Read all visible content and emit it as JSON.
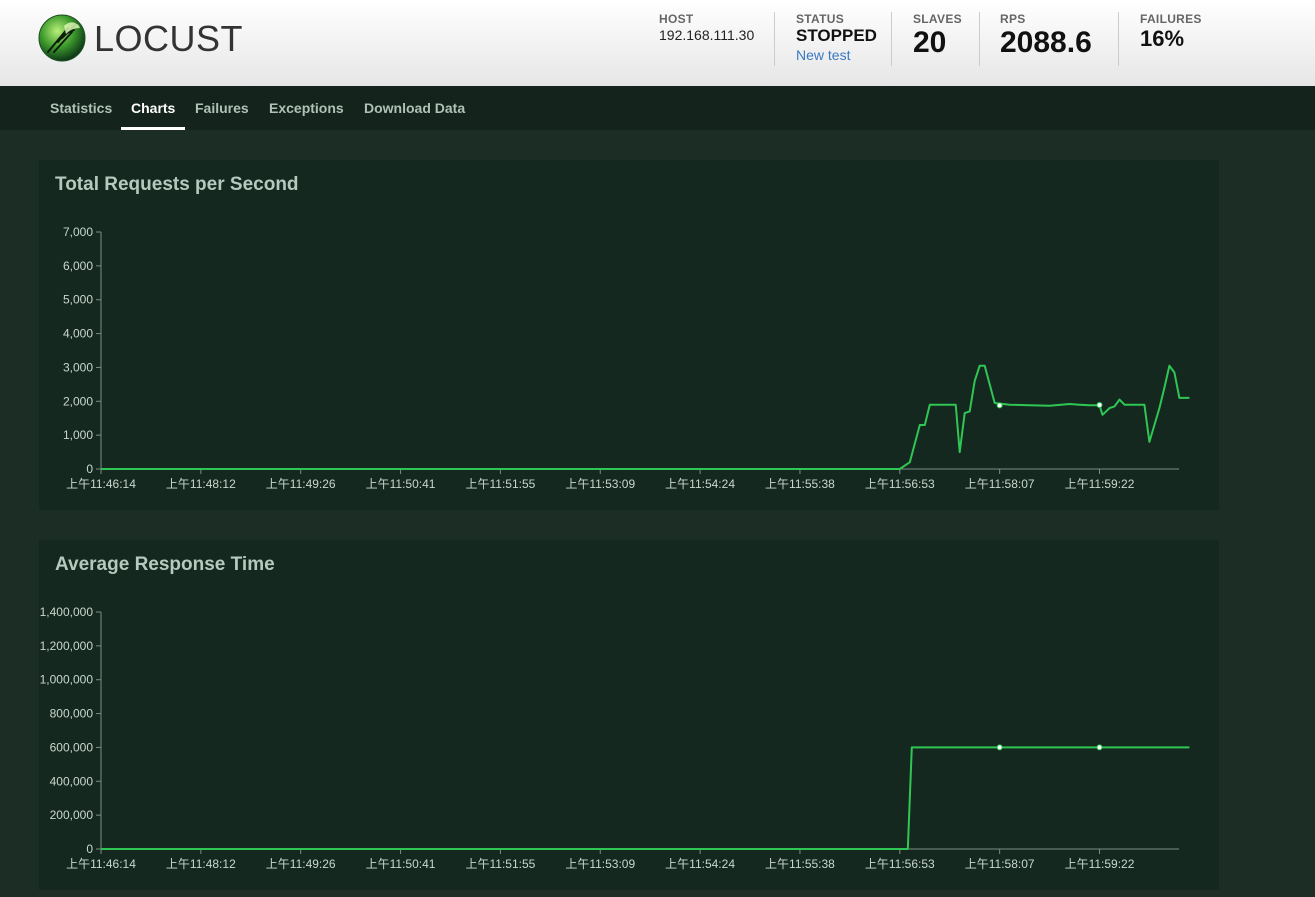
{
  "app": {
    "logo_text": "LOCUST"
  },
  "stats": {
    "host_label": "HOST",
    "host_value": "192.168.111.30",
    "status_label": "STATUS",
    "status_value": "STOPPED",
    "new_test_label": "New test",
    "slaves_label": "SLAVES",
    "slaves_value": "20",
    "rps_label": "RPS",
    "rps_value": "2088.6",
    "failures_label": "FAILURES",
    "failures_value": "16%"
  },
  "nav": {
    "tabs": [
      "Statistics",
      "Charts",
      "Failures",
      "Exceptions",
      "Download Data"
    ],
    "active": "Charts"
  },
  "colors": {
    "line": "#2fc654",
    "panel": "#152820",
    "page": "#1b2d25"
  },
  "chart_data": [
    {
      "type": "line",
      "title": "Total Requests per Second",
      "categories": [
        "上午11:46:14",
        "上午11:48:12",
        "上午11:49:26",
        "上午11:50:41",
        "上午11:51:55",
        "上午11:53:09",
        "上午11:54:24",
        "上午11:55:38",
        "上午11:56:53",
        "上午11:58:07",
        "上午11:59:22"
      ],
      "ylim": [
        0,
        7000
      ],
      "yticks": [
        "0",
        "1,000",
        "2,000",
        "3,000",
        "4,000",
        "5,000",
        "6,000",
        "7,000"
      ],
      "series": [
        {
          "values": [
            [
              0,
              0
            ],
            [
              8.0,
              0
            ],
            [
              8.1,
              200
            ],
            [
              8.2,
              1300
            ],
            [
              8.25,
              1300
            ],
            [
              8.3,
              1900
            ],
            [
              8.5,
              1900
            ],
            [
              8.56,
              1900
            ],
            [
              8.6,
              500
            ],
            [
              8.65,
              1650
            ],
            [
              8.7,
              1700
            ],
            [
              8.75,
              2600
            ],
            [
              8.8,
              3050
            ],
            [
              8.85,
              3050
            ],
            [
              8.9,
              2500
            ],
            [
              8.95,
              1950
            ],
            [
              9.1,
              1900
            ],
            [
              9.3,
              1880
            ],
            [
              9.5,
              1870
            ],
            [
              9.7,
              1920
            ],
            [
              9.8,
              1900
            ],
            [
              9.9,
              1880
            ],
            [
              10.0,
              1880
            ],
            [
              10.03,
              1600
            ],
            [
              10.1,
              1800
            ],
            [
              10.15,
              1850
            ],
            [
              10.2,
              2050
            ],
            [
              10.25,
              1900
            ],
            [
              10.45,
              1900
            ],
            [
              10.5,
              800
            ],
            [
              10.55,
              1300
            ],
            [
              10.6,
              1800
            ],
            [
              10.65,
              2400
            ],
            [
              10.7,
              3050
            ],
            [
              10.75,
              2850
            ],
            [
              10.8,
              2100
            ],
            [
              10.9,
              2100
            ]
          ]
        }
      ],
      "markers": [
        [
          9.0,
          1880
        ],
        [
          10.0,
          1890
        ]
      ]
    },
    {
      "type": "line",
      "title": "Average Response Time",
      "categories": [
        "上午11:46:14",
        "上午11:48:12",
        "上午11:49:26",
        "上午11:50:41",
        "上午11:51:55",
        "上午11:53:09",
        "上午11:54:24",
        "上午11:55:38",
        "上午11:56:53",
        "上午11:58:07",
        "上午11:59:22"
      ],
      "ylim": [
        0,
        1400000
      ],
      "yticks": [
        "0",
        "200,000",
        "400,000",
        "600,000",
        "800,000",
        "1,000,000",
        "1,200,000",
        "1,400,000"
      ],
      "series": [
        {
          "values": [
            [
              0,
              0
            ],
            [
              8.08,
              0
            ],
            [
              8.12,
              600000
            ],
            [
              10.9,
              600000
            ]
          ]
        }
      ],
      "markers": [
        [
          9.0,
          600000
        ],
        [
          10.0,
          600000
        ]
      ]
    }
  ]
}
